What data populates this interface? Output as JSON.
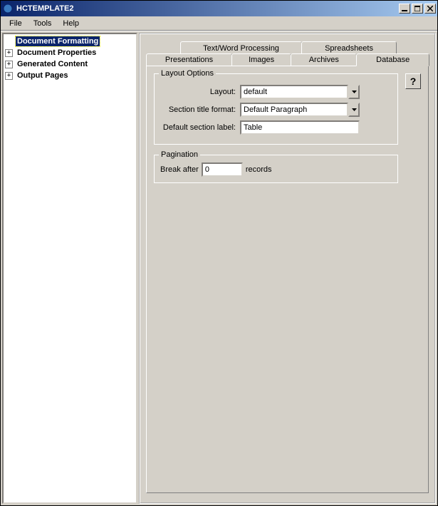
{
  "window": {
    "title": "HCTEMPLATE2"
  },
  "menubar": {
    "items": [
      "File",
      "Tools",
      "Help"
    ]
  },
  "sidebar": {
    "items": [
      {
        "label": "Document Formatting",
        "active": true,
        "expandable": false
      },
      {
        "label": "Document Properties",
        "active": false,
        "expandable": true
      },
      {
        "label": "Generated Content",
        "active": false,
        "expandable": true
      },
      {
        "label": "Output Pages",
        "active": false,
        "expandable": true
      }
    ]
  },
  "tabs": {
    "row1": [
      {
        "label": "Text/Word Processing",
        "active": false
      },
      {
        "label": "Spreadsheets",
        "active": false
      }
    ],
    "row2": [
      {
        "label": "Presentations",
        "active": false
      },
      {
        "label": "Images",
        "active": false
      },
      {
        "label": "Archives",
        "active": false
      },
      {
        "label": "Database",
        "active": true
      }
    ]
  },
  "help_button": "?",
  "layout_options": {
    "legend": "Layout Options",
    "layout_label": "Layout:",
    "layout_value": "default",
    "section_title_label": "Section title format:",
    "section_title_value": "Default Paragraph",
    "default_section_label_label": "Default section label:",
    "default_section_label_value": "Table"
  },
  "pagination": {
    "legend": "Pagination",
    "break_after_label": "Break after",
    "break_after_value": "0",
    "records_label": "records"
  }
}
